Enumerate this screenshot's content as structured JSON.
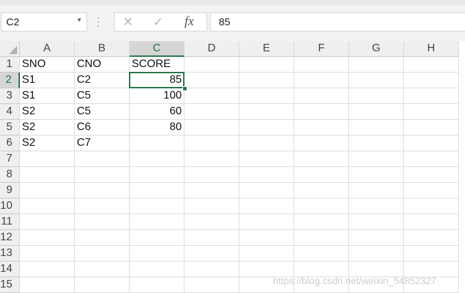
{
  "formula_bar": {
    "name_box": "C2",
    "formula": "85",
    "cancel_icon": "✕",
    "enter_icon": "✓",
    "fx_icon": "fx"
  },
  "columns": [
    "A",
    "B",
    "C",
    "D",
    "E",
    "F",
    "G",
    "H"
  ],
  "rows": [
    "1",
    "2",
    "3",
    "4",
    "5",
    "6",
    "7",
    "8",
    "9",
    "10",
    "11",
    "12",
    "13",
    "14",
    "15"
  ],
  "cells": [
    [
      "SNO",
      "CNO",
      "SCORE"
    ],
    [
      "S1",
      "C2",
      "85"
    ],
    [
      "S1",
      "C5",
      "100"
    ],
    [
      "S2",
      "C5",
      "60"
    ],
    [
      "S2",
      "C6",
      "80"
    ],
    [
      "S2",
      "C7",
      ""
    ]
  ],
  "numeric_columns": [
    2
  ],
  "selected_column": "C",
  "selected_row": "2",
  "watermark": "https://blog.csdn.net/weixin_54852327",
  "colors": {
    "accent": "#217346",
    "header_bg": "#efefef",
    "gridline": "#dcdcdc"
  }
}
